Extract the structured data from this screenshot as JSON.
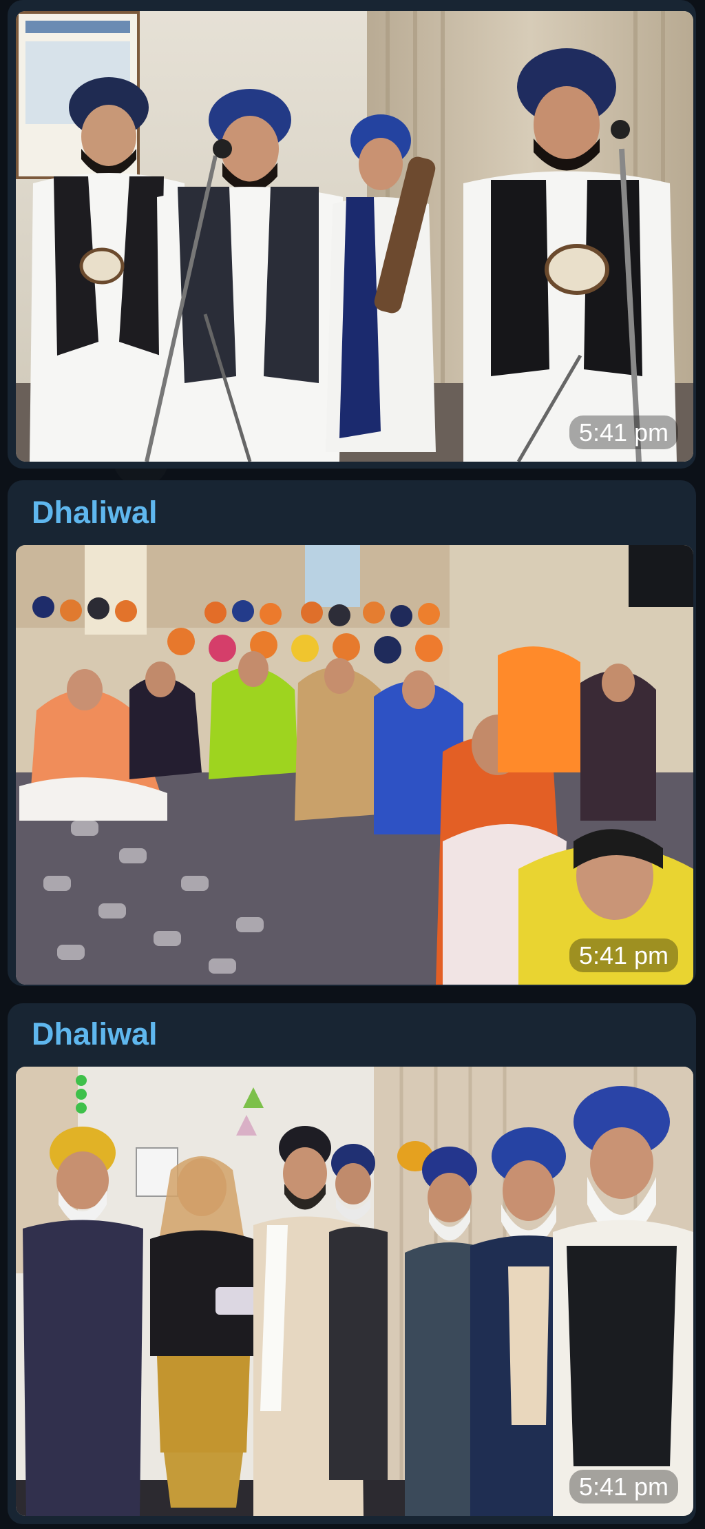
{
  "messages": [
    {
      "sender": "",
      "time": "5:41 pm",
      "photo_icon": "photo-musicians-icon"
    },
    {
      "sender": "Dhaliwal",
      "time": "5:41 pm",
      "photo_icon": "photo-congregation-icon"
    },
    {
      "sender": "Dhaliwal",
      "time": "5:41 pm",
      "photo_icon": "photo-group-icon"
    }
  ],
  "colors": {
    "background": "#0c1118",
    "bubble": "#182533",
    "sender_name": "#5fb7ee",
    "time_text": "#ffffff"
  }
}
